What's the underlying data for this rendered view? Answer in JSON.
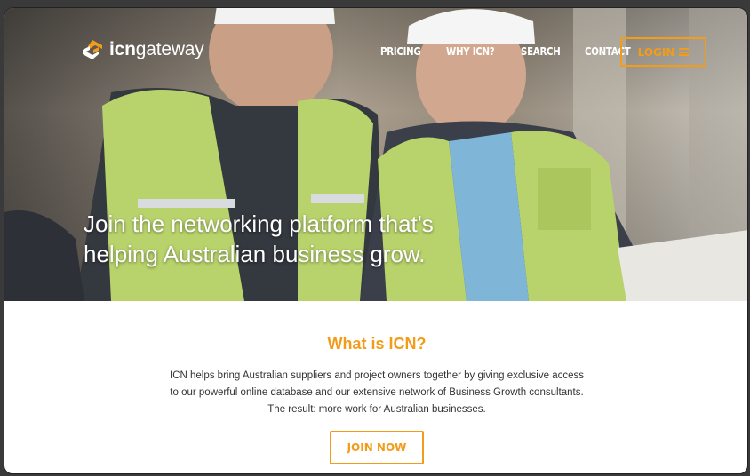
{
  "header": {
    "logo_bold": "icn",
    "logo_rest": "gateway",
    "nav": [
      {
        "label": "PRICING"
      },
      {
        "label": "WHY ICN?"
      },
      {
        "label": "SEARCH"
      },
      {
        "label": "CONTACT"
      }
    ],
    "login_label": "LOGIN"
  },
  "hero": {
    "headline_line1": "Join the networking platform that's",
    "headline_line2": "helping Australian business grow."
  },
  "info": {
    "title": "What is ICN?",
    "line1": "ICN helps bring Australian suppliers and project owners together by giving exclusive access",
    "line2": "to our powerful online database and our extensive network of Business Growth consultants.",
    "line3": "The result: more work for Australian businesses.",
    "cta_label": "JOIN NOW"
  },
  "colors": {
    "accent": "#f39c1a",
    "text": "#333333",
    "white": "#ffffff"
  },
  "icons": {
    "logo": "icn-logo-icon",
    "menu": "hamburger-icon"
  }
}
